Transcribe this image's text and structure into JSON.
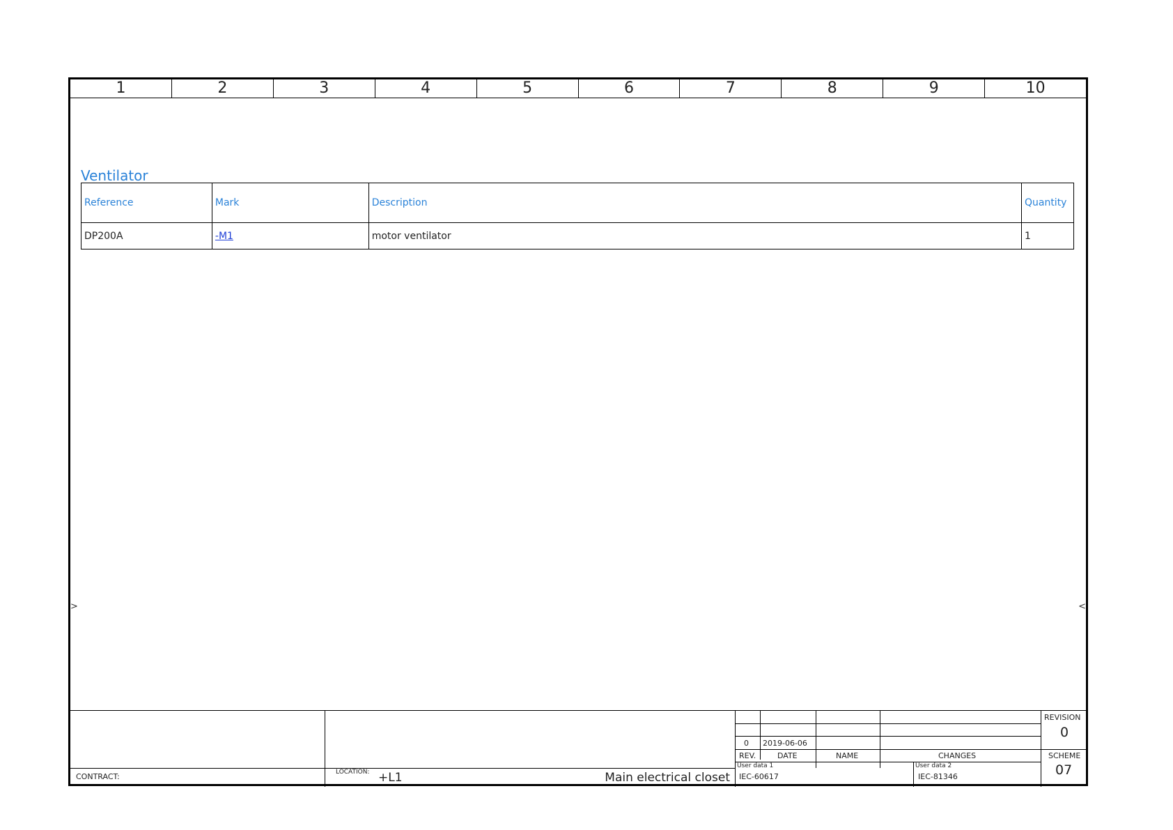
{
  "ruler": [
    "1",
    "2",
    "3",
    "4",
    "5",
    "6",
    "7",
    "8",
    "9",
    "10"
  ],
  "section": {
    "title": "Ventilator"
  },
  "table": {
    "headers": [
      "Reference",
      "Mark",
      "Description",
      "Quantity"
    ],
    "rows": [
      {
        "reference": "DP200A",
        "mark": "-M1",
        "description": "motor ventilator",
        "quantity": "1"
      }
    ]
  },
  "markers": {
    "left": ">",
    "right": "<"
  },
  "title_block": {
    "contract_label": "CONTRACT:",
    "location_label": "LOCATION:",
    "location_value": "+L1",
    "location_name": "Main electrical closet",
    "revision_rows": [
      {
        "rev": "0",
        "date": "2019-06-06",
        "name": "",
        "changes": ""
      }
    ],
    "col_rev": "REV.",
    "col_date": "DATE",
    "col_name": "NAME",
    "col_changes": "CHANGES",
    "user_data_1_label": "User data 1",
    "user_data_1_value": "IEC-60617",
    "user_data_2_label": "User data 2",
    "user_data_2_value": "IEC-81346",
    "revision_label": "REVISION",
    "revision_value": "0",
    "scheme_label": "SCHEME",
    "scheme_value": "07"
  }
}
